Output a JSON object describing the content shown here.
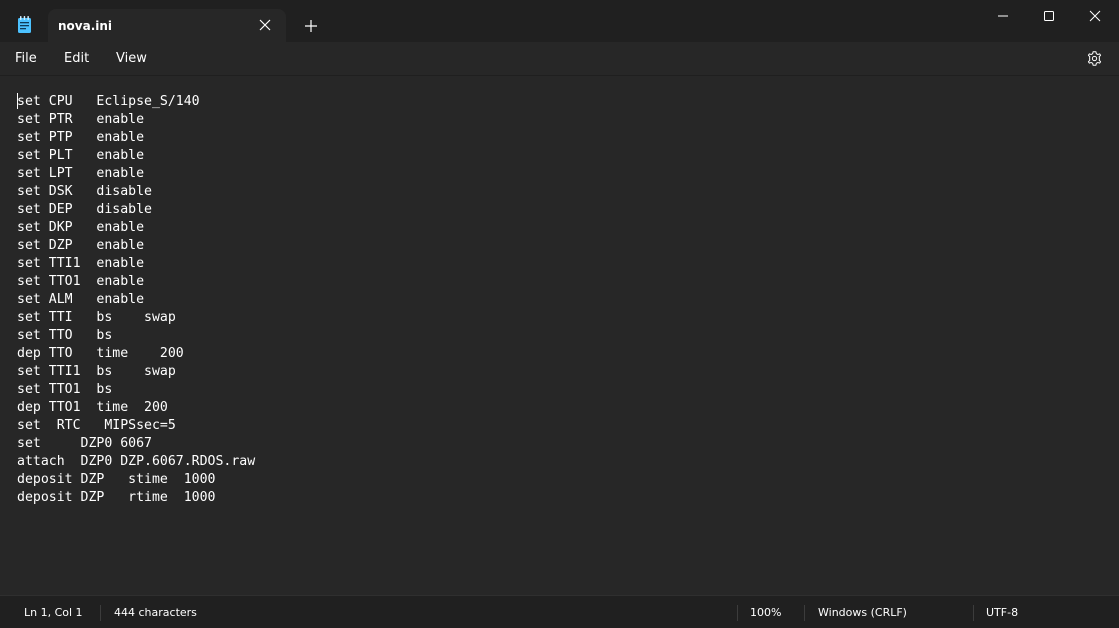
{
  "window": {
    "tab_title": "nova.ini",
    "icons": {
      "app": "notepad-icon",
      "tab_close": "close-icon",
      "new_tab": "plus-icon",
      "minimize": "minimize-icon",
      "maximize": "maximize-icon",
      "close": "close-icon",
      "settings": "gear-icon"
    }
  },
  "menu": {
    "file": "File",
    "edit": "Edit",
    "view": "View"
  },
  "editor": {
    "content": "set CPU   Eclipse_S/140\nset PTR   enable\nset PTP   enable\nset PLT   enable\nset LPT   enable\nset DSK   disable\nset DEP   disable\nset DKP   enable\nset DZP   enable\nset TTI1  enable\nset TTO1  enable\nset ALM   enable\nset TTI   bs    swap\nset TTO   bs\ndep TTO   time    200\nset TTI1  bs    swap\nset TTO1  bs\ndep TTO1  time  200\nset  RTC   MIPSsec=5\nset     DZP0 6067\nattach  DZP0 DZP.6067.RDOS.raw\ndeposit DZP   stime  1000\ndeposit DZP   rtime  1000"
  },
  "status": {
    "position": "Ln 1, Col 1",
    "characters": "444 characters",
    "zoom": "100%",
    "line_ending": "Windows (CRLF)",
    "encoding": "UTF-8"
  },
  "colors": {
    "background": "#272727",
    "titlebar": "#202020",
    "text": "#ffffff"
  }
}
